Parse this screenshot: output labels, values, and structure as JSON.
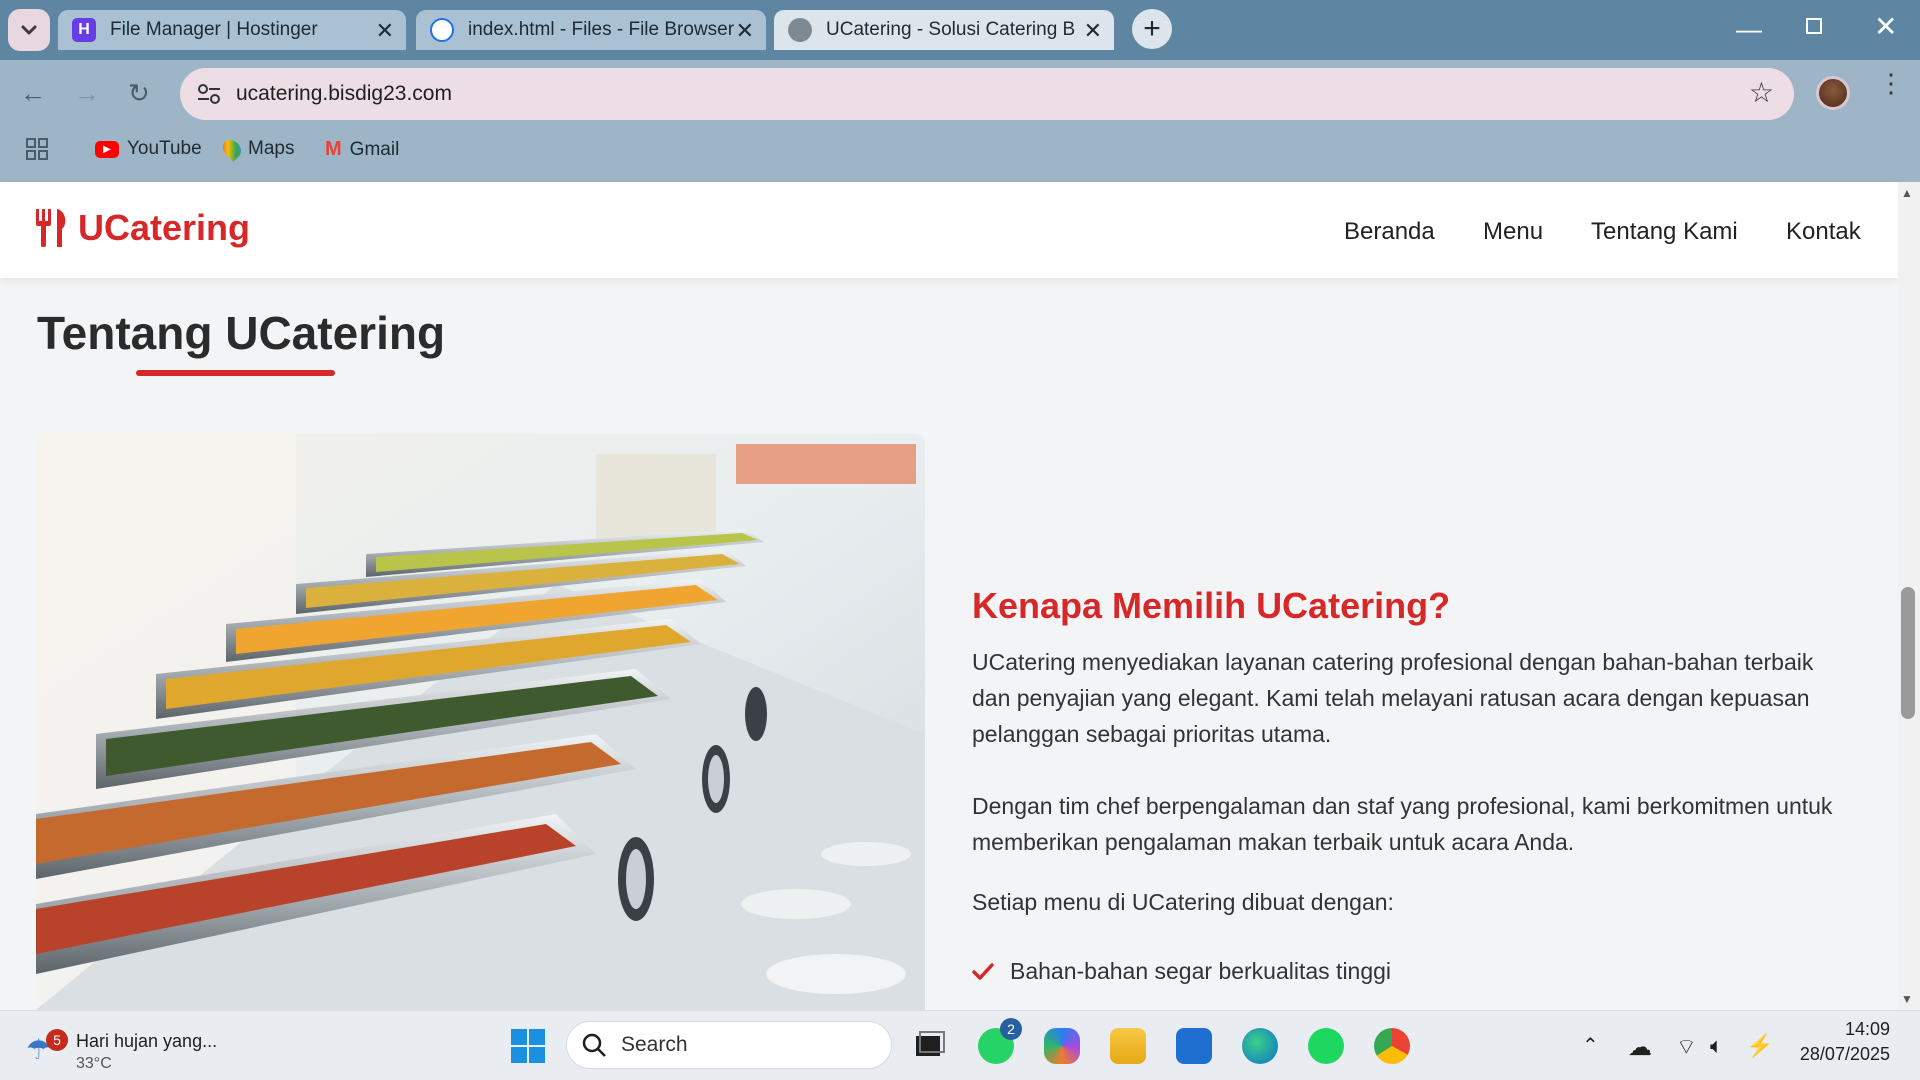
{
  "browser": {
    "tabs": [
      {
        "title": "File Manager | Hostinger",
        "active": false
      },
      {
        "title": "index.html - Files - File Browser",
        "active": false
      },
      {
        "title": "UCatering - Solusi Catering Ber",
        "active": true
      }
    ],
    "new_tab_label": "+",
    "url": "ucatering.bisdig23.com",
    "bookmarks": [
      {
        "label": "YouTube"
      },
      {
        "label": "Maps"
      },
      {
        "label": "Gmail"
      }
    ]
  },
  "site": {
    "brand": "UCatering",
    "nav": [
      "Beranda",
      "Menu",
      "Tentang Kami",
      "Kontak"
    ],
    "section_title": "Tentang UCatering",
    "why_title": "Kenapa Memilih UCatering?",
    "paragraphs": [
      "UCatering menyediakan layanan catering profesional dengan bahan-bahan terbaik dan penyajian yang elegant. Kami telah melayani ratusan acara dengan kepuasan pelanggan sebagai prioritas utama.",
      "Dengan tim chef berpengalaman dan staf yang profesional, kami berkomitmen untuk memberikan pengalaman makan terbaik untuk acara Anda.",
      "Setiap menu di UCatering dibuat dengan:"
    ],
    "features": [
      "Bahan-bahan segar berkualitas tinggi"
    ],
    "accent_color": "#d62828"
  },
  "taskbar": {
    "weather_text": "Hari hujan yang...",
    "weather_temp": "33°C",
    "weather_badge": "5",
    "search_placeholder": "Search",
    "whatsapp_badge": "2",
    "time": "14:09",
    "date": "28/07/2025"
  }
}
